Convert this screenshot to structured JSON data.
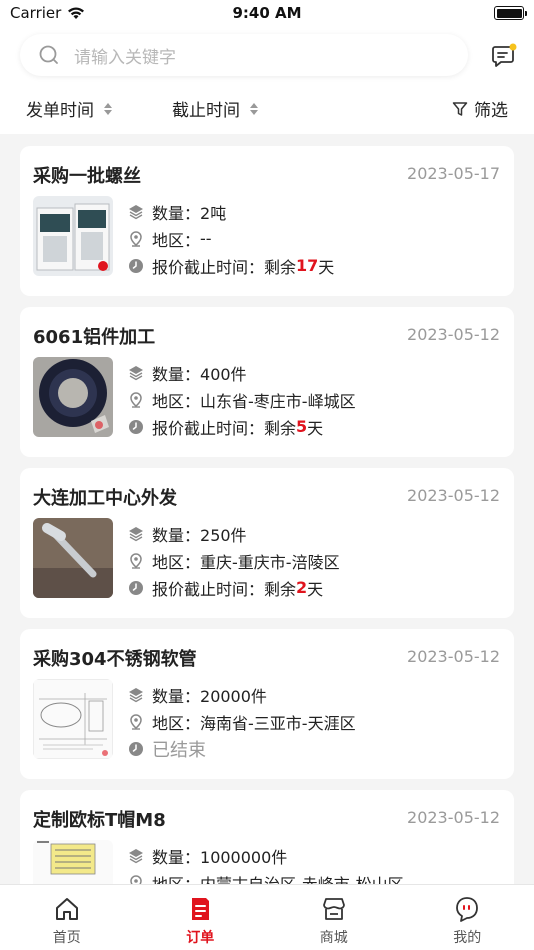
{
  "status_bar": {
    "carrier": "Carrier",
    "time": "9:40 AM"
  },
  "search": {
    "placeholder": "请输入关键字"
  },
  "filters": {
    "issue_time": "发单时间",
    "deadline": "截止时间",
    "filter": "筛选"
  },
  "labels": {
    "quantity": "数量：",
    "region": "地区：",
    "deadline": "报价截止时间：",
    "remaining_prefix": "剩余",
    "days_suffix": "天"
  },
  "orders": [
    {
      "title": "采购一批螺丝",
      "date": "2023-05-17",
      "quantity": "2吨",
      "region": "--",
      "days": "17",
      "ended": false
    },
    {
      "title": "6061铝件加工",
      "date": "2023-05-12",
      "quantity": "400件",
      "region": "山东省-枣庄市-峄城区",
      "days": "5",
      "ended": false
    },
    {
      "title": "大连加工中心外发",
      "date": "2023-05-12",
      "quantity": "250件",
      "region": "重庆-重庆市-涪陵区",
      "days": "2",
      "ended": false
    },
    {
      "title": "采购304不锈钢软管",
      "date": "2023-05-12",
      "quantity": "20000件",
      "region": "海南省-三亚市-天涯区",
      "ended_text": "已结束",
      "ended": true
    },
    {
      "title": "定制欧标T帽M8",
      "date": "2023-05-12",
      "quantity": "1000000件",
      "region": "内蒙古自治区-赤峰市-松山区",
      "ended": false
    }
  ],
  "tabbar": [
    {
      "label": "首页",
      "icon": "home-icon"
    },
    {
      "label": "订单",
      "icon": "order-icon",
      "active": true
    },
    {
      "label": "商城",
      "icon": "store-icon"
    },
    {
      "label": "我的",
      "icon": "profile-icon"
    }
  ],
  "colors": {
    "accent": "#e0141e",
    "muted": "#9a9a9a",
    "background": "#f4f4f4"
  }
}
